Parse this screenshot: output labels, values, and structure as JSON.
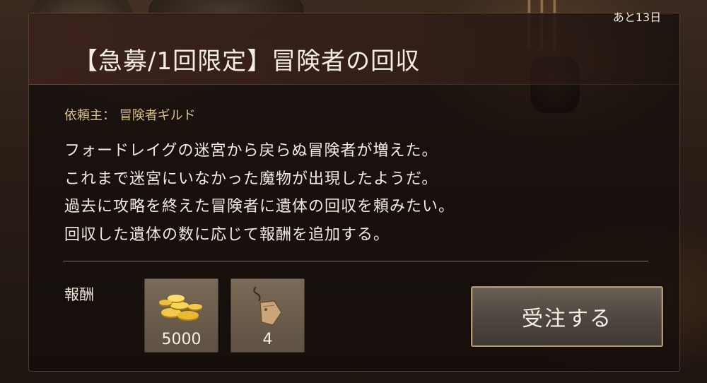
{
  "quest": {
    "title": "【急募/1回限定】冒険者の回収",
    "days_left": "あと13日",
    "client_label": "依頼主：",
    "client_name": "冒険者ギルド",
    "description": [
      "フォードレイグの迷宮から戻らぬ冒険者が増えた。",
      "これまで迷宮にいなかった魔物が出現したようだ。",
      "過去に攻略を終えた冒険者に遺体の回収を頼みたい。",
      "回収した遺体の数に応じて報酬を追加する。"
    ]
  },
  "rewards": {
    "label": "報酬",
    "items": [
      {
        "icon": "gold-coins-icon",
        "count": "5000"
      },
      {
        "icon": "tag-pouch-icon",
        "count": "4"
      }
    ]
  },
  "actions": {
    "accept_label": "受注する"
  },
  "colors": {
    "accent_gold": "#d6c08a",
    "button_border": "#b89a6a",
    "panel_bg": "#120d0a"
  }
}
